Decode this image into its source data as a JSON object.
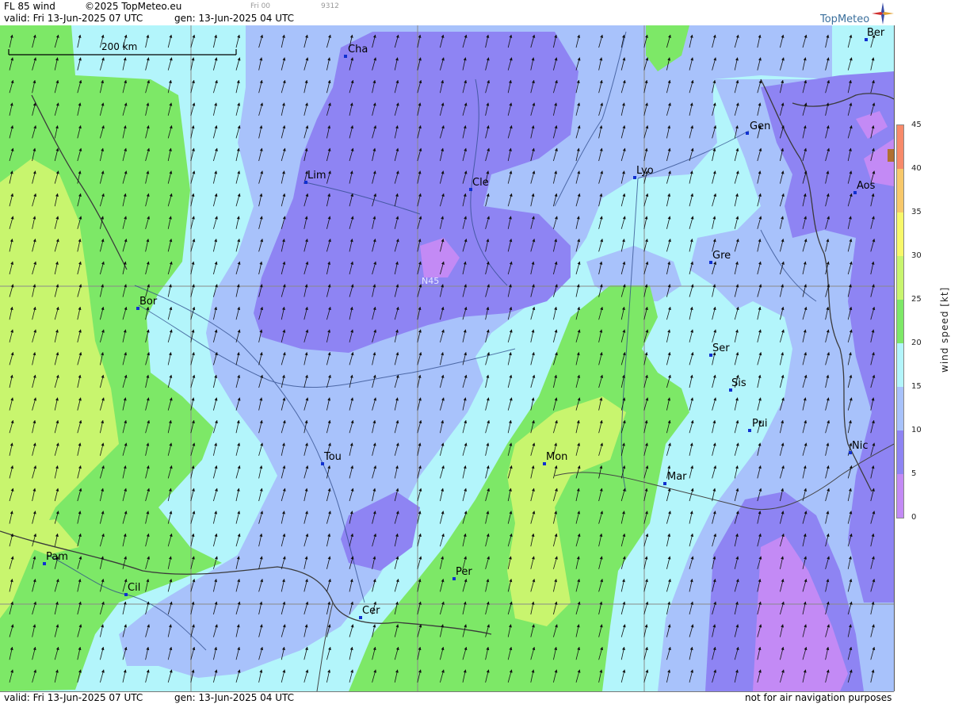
{
  "header": {
    "title": "FL 85 wind",
    "copyright": "©2025 TopMeteo.eu",
    "valid": "valid:  Fri  13-Jun-2025  07 UTC",
    "gen": "gen: 13-Jun-2025 04 UTC",
    "run_small": "Fri 00",
    "code_small": "9312"
  },
  "footer": {
    "valid": "valid:  Fri  13-Jun-2025  07 UTC",
    "gen": "gen: 13-Jun-2025 04 UTC",
    "disclaimer": "not for air navigation purposes"
  },
  "logo": {
    "text": "TopMeteo",
    "icon": "compass-star-icon"
  },
  "scale": {
    "label": "200 km"
  },
  "grid_label": "N45",
  "cities": [
    {
      "name": "Cha"
    },
    {
      "name": "Ber"
    },
    {
      "name": "Gen"
    },
    {
      "name": "Lim"
    },
    {
      "name": "Cle"
    },
    {
      "name": "Lyo"
    },
    {
      "name": "Aos"
    },
    {
      "name": "Gre"
    },
    {
      "name": "Bor"
    },
    {
      "name": "Ser"
    },
    {
      "name": "Sis"
    },
    {
      "name": "Pui"
    },
    {
      "name": "Tou"
    },
    {
      "name": "Mon"
    },
    {
      "name": "Mar"
    },
    {
      "name": "Nic"
    },
    {
      "name": "Pam"
    },
    {
      "name": "Per"
    },
    {
      "name": "Cil"
    },
    {
      "name": "Cer"
    }
  ],
  "legend": {
    "title": "wind  speed  [kt]",
    "ticks": [
      "45",
      "40",
      "35",
      "30",
      "25",
      "20",
      "15",
      "10",
      "5",
      "0"
    ],
    "colors": {
      "0-5": "#c38af5",
      "5-10": "#8e84f3",
      "10-15": "#a8c2fb",
      "15-20": "#b3f5fb",
      "20-25": "#7de867",
      "25-30": "#c8f56e",
      "30-35": "#f8f86a",
      "35-40": "#f8c86a",
      "40-45": "#f88a6a"
    }
  },
  "wind_direction": "south-west to north-east",
  "colors": {
    "grid": "#8a8a8a",
    "borders": "#3a3a3a",
    "rivers": "#2e4a8a",
    "city_marker": "#1030d0"
  }
}
